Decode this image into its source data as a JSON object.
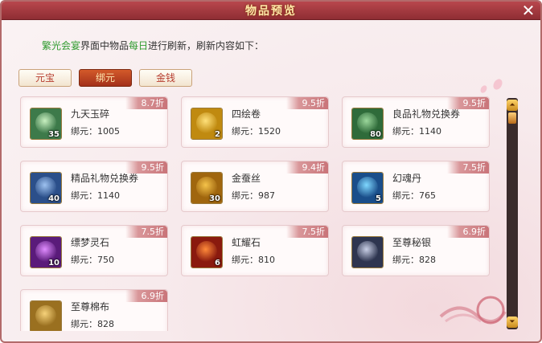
{
  "window": {
    "title": "物品预览",
    "close_label": "✕"
  },
  "intro": {
    "part1": "繁光会宴",
    "part2": "界面中物品",
    "part3": "每日",
    "part4": "进行刷新，刷新内容如下："
  },
  "tabs": [
    {
      "label": "元宝",
      "active": false
    },
    {
      "label": "绑元",
      "active": true
    },
    {
      "label": "金钱",
      "active": false
    }
  ],
  "items": [
    {
      "name": "九天玉碎",
      "price_label": "绑元：",
      "price": "1005",
      "discount": "8.7折",
      "qty": "35",
      "icon": "jade-orb-icon",
      "colors": [
        "#3d7a4a",
        "#c8f0c0"
      ]
    },
    {
      "name": "四绘卷",
      "price_label": "绑元：",
      "price": "1520",
      "discount": "9.5折",
      "qty": "2",
      "icon": "scroll-icon",
      "colors": [
        "#c08a10",
        "#ffe17a"
      ]
    },
    {
      "name": "良品礼物兑换券",
      "price_label": "绑元：",
      "price": "1140",
      "discount": "9.5折",
      "qty": "80",
      "icon": "green-coupon-icon",
      "colors": [
        "#2f6b3a",
        "#9bd79b"
      ]
    },
    {
      "name": "精品礼物兑换券",
      "price_label": "绑元：",
      "price": "1140",
      "discount": "9.5折",
      "qty": "40",
      "icon": "blue-coupon-icon",
      "colors": [
        "#2b4f8a",
        "#9ec2f0"
      ]
    },
    {
      "name": "金蚕丝",
      "price_label": "绑元：",
      "price": "987",
      "discount": "9.4折",
      "qty": "30",
      "icon": "silk-icon",
      "colors": [
        "#a0660e",
        "#f5c34a"
      ]
    },
    {
      "name": "幻魂丹",
      "price_label": "绑元：",
      "price": "765",
      "discount": "7.5折",
      "qty": "5",
      "icon": "pill-icon",
      "colors": [
        "#1a4e8a",
        "#7fd8ff"
      ]
    },
    {
      "name": "缥梦灵石",
      "price_label": "绑元：",
      "price": "750",
      "discount": "7.5折",
      "qty": "10",
      "icon": "purple-gem-icon",
      "colors": [
        "#5a1b7a",
        "#e08cff"
      ]
    },
    {
      "name": "虹耀石",
      "price_label": "绑元：",
      "price": "810",
      "discount": "7.5折",
      "qty": "6",
      "icon": "red-stone-icon",
      "colors": [
        "#8a1a0e",
        "#ff8a3a"
      ]
    },
    {
      "name": "至尊秘银",
      "price_label": "绑元：",
      "price": "828",
      "discount": "6.9折",
      "qty": "",
      "icon": "silver-ore-icon",
      "colors": [
        "#2e3550",
        "#c9cfe6"
      ]
    },
    {
      "name": "至尊棉布",
      "price_label": "绑元：",
      "price": "828",
      "discount": "6.9折",
      "qty": "",
      "icon": "cloth-icon",
      "colors": [
        "#9a7020",
        "#f6d27a"
      ]
    }
  ],
  "scrollbar": {
    "up_label": "⏶",
    "down_label": "⏷"
  }
}
